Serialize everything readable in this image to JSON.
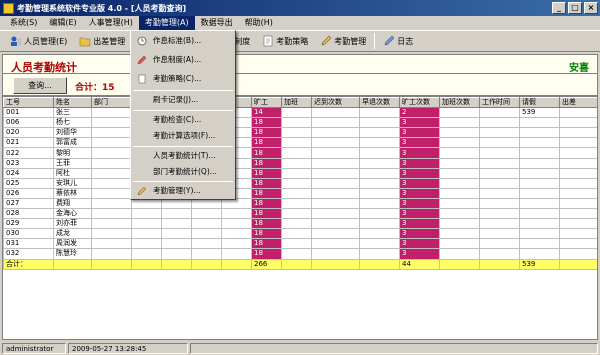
{
  "window": {
    "title": "考勤管理系统软件专业版 4.0 - [人员考勤查询]",
    "min": "_",
    "max": "□",
    "close": "×"
  },
  "menubar": [
    "系统(S)",
    "编辑(E)",
    "人事管理(H)",
    "考勤管理(A)",
    "数据导出",
    "帮助(H)"
  ],
  "toolbar": {
    "staff": "人员管理(E)",
    "leave": "出差管理",
    "system": "制度",
    "policy": "考勤策略",
    "attendance": "考勤管理",
    "log": "日志"
  },
  "dropdown": [
    "作息标准(B)...",
    "作息制度(A)...",
    "考勤策略(C)...",
    "刷卡记录(J)...",
    "考勤检查(C)...",
    "考勤计算选项(F)...",
    "人员考勤统计(T)...",
    "部门考勤统计(Q)...",
    "考勤管理(Y)..."
  ],
  "header": {
    "title": "人员考勤统计",
    "user": "安喜",
    "query": "查询...",
    "total": "合计：15"
  },
  "grid": {
    "columns": [
      "工号",
      "姓名",
      "部门",
      "",
      "",
      "",
      "",
      "旷工",
      "加班",
      "迟到次数",
      "早退次数",
      "旷工次数",
      "加班次数",
      "工作时间",
      "请假",
      "出差"
    ],
    "rows": [
      [
        "001",
        "张三",
        "",
        "",
        "",
        "",
        "",
        "14",
        "",
        "",
        "",
        "2",
        "",
        "",
        "539",
        ""
      ],
      [
        "006",
        "杨七",
        "",
        "",
        "",
        "",
        "",
        "18",
        "",
        "",
        "",
        "3",
        "",
        "",
        "",
        ""
      ],
      [
        "020",
        "刘德华",
        "",
        "",
        "",
        "",
        "",
        "18",
        "",
        "",
        "",
        "3",
        "",
        "",
        "",
        ""
      ],
      [
        "021",
        "郭富成",
        "",
        "",
        "",
        "",
        "",
        "18",
        "",
        "",
        "",
        "3",
        "",
        "",
        "",
        ""
      ],
      [
        "022",
        "黎明",
        "",
        "",
        "",
        "",
        "",
        "18",
        "",
        "",
        "",
        "3",
        "",
        "",
        "",
        ""
      ],
      [
        "023",
        "王菲",
        "",
        "",
        "",
        "",
        "",
        "18",
        "",
        "",
        "",
        "3",
        "",
        "",
        "",
        ""
      ],
      [
        "024",
        "阿杜",
        "",
        "",
        "",
        "",
        "",
        "18",
        "",
        "",
        "",
        "3",
        "",
        "",
        "",
        ""
      ],
      [
        "025",
        "安琪儿",
        "",
        "",
        "",
        "",
        "",
        "18",
        "",
        "",
        "",
        "3",
        "",
        "",
        "",
        ""
      ],
      [
        "026",
        "蔡依林",
        "",
        "",
        "",
        "",
        "",
        "18",
        "",
        "",
        "",
        "3",
        "",
        "",
        "",
        ""
      ],
      [
        "027",
        "费翔",
        "",
        "",
        "",
        "",
        "",
        "18",
        "",
        "",
        "",
        "3",
        "",
        "",
        "",
        ""
      ],
      [
        "028",
        "金海心",
        "",
        "",
        "",
        "",
        "",
        "18",
        "",
        "",
        "",
        "3",
        "",
        "",
        "",
        ""
      ],
      [
        "029",
        "刘亦菲",
        "",
        "",
        "",
        "",
        "",
        "18",
        "",
        "",
        "",
        "3",
        "",
        "",
        "",
        ""
      ],
      [
        "030",
        "成龙",
        "",
        "",
        "",
        "",
        "",
        "18",
        "",
        "",
        "",
        "3",
        "",
        "",
        "",
        ""
      ],
      [
        "031",
        "周润发",
        "",
        "",
        "",
        "",
        "",
        "18",
        "",
        "",
        "",
        "3",
        "",
        "",
        "",
        ""
      ],
      [
        "032",
        "陈慧玲",
        "",
        "",
        "",
        "",
        "",
        "18",
        "",
        "",
        "",
        "3",
        "",
        "",
        "",
        ""
      ]
    ],
    "total_row": [
      "合计：",
      "",
      "",
      "",
      "",
      "",
      "",
      "266",
      "",
      "",
      "",
      "44",
      "",
      "",
      "539",
      ""
    ]
  },
  "status": {
    "user": "administrator",
    "time": "2009-05-27 13:28:45"
  },
  "colors": {
    "highlight": "#c0206a",
    "total_bg": "#ffff66",
    "title_red": "#b00000",
    "user_green": "#008000"
  }
}
